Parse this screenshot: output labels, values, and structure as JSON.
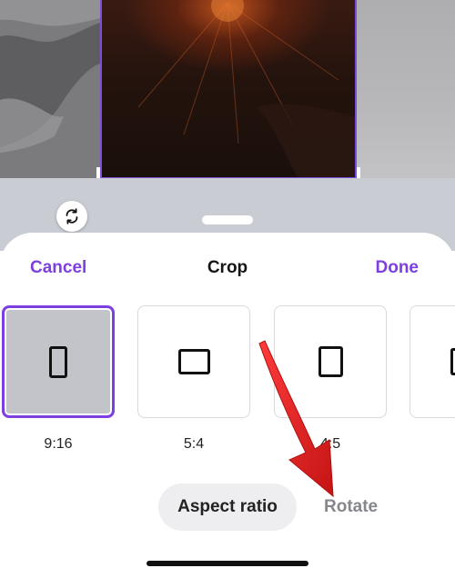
{
  "header": {
    "cancel_label": "Cancel",
    "title": "Crop",
    "done_label": "Done"
  },
  "ratio_options": [
    {
      "label": "9:16",
      "selected": true
    },
    {
      "label": "5:4",
      "selected": false
    },
    {
      "label": "4:5",
      "selected": false
    },
    {
      "label": "",
      "selected": false
    }
  ],
  "tabs": {
    "aspect_ratio_label": "Aspect ratio",
    "rotate_label": "Rotate",
    "active": "Aspect ratio"
  },
  "icons": {
    "rotate_fab": "rotate-arrows-icon",
    "annotation": "red-arrow-annotation"
  },
  "colors": {
    "accent": "#7d3fe0",
    "annotation_red": "#e02020",
    "sheet_bg": "#ffffff",
    "band_gray": "#c9ccd3"
  }
}
